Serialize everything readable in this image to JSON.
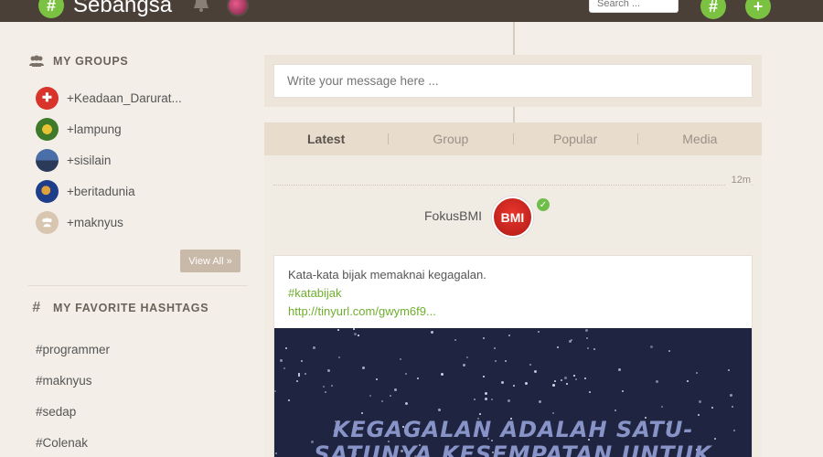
{
  "app": {
    "name": "Sebangsa",
    "search_placeholder": "Search ..."
  },
  "sidebar": {
    "groups_title": "MY GROUPS",
    "groups": [
      {
        "label": "+Keadaan_Darurat...",
        "color": "#d9342b"
      },
      {
        "label": "+lampung",
        "color": "#3f7a2b"
      },
      {
        "label": "+sisilain",
        "color": "#2c3a5a"
      },
      {
        "label": "+beritadunia",
        "color": "#1f3e8a"
      },
      {
        "label": "+maknyus",
        "color": "#d8c6b0"
      }
    ],
    "view_all_label": "View All »",
    "hashtags_title": "MY FAVORITE HASHTAGS",
    "hashtags": [
      "#programmer",
      "#maknyus",
      "#sedap",
      "#Colenak"
    ]
  },
  "composer": {
    "placeholder": "Write your message here ..."
  },
  "tabs": [
    "Latest",
    "Group",
    "Popular",
    "Media"
  ],
  "post": {
    "time": "12m",
    "author": "FokusBMI",
    "avatar_text": "BMI",
    "text": "Kata-kata bijak memaknai kegagalan.",
    "hashtag": "#katabijak",
    "link": "http://tinyurl.com/gwym6f9...",
    "image_quote_line1": "KEGAGALAN ADALAH SATU-",
    "image_quote_line2": "SATUNYA KESEMPATAN UNTUK"
  }
}
